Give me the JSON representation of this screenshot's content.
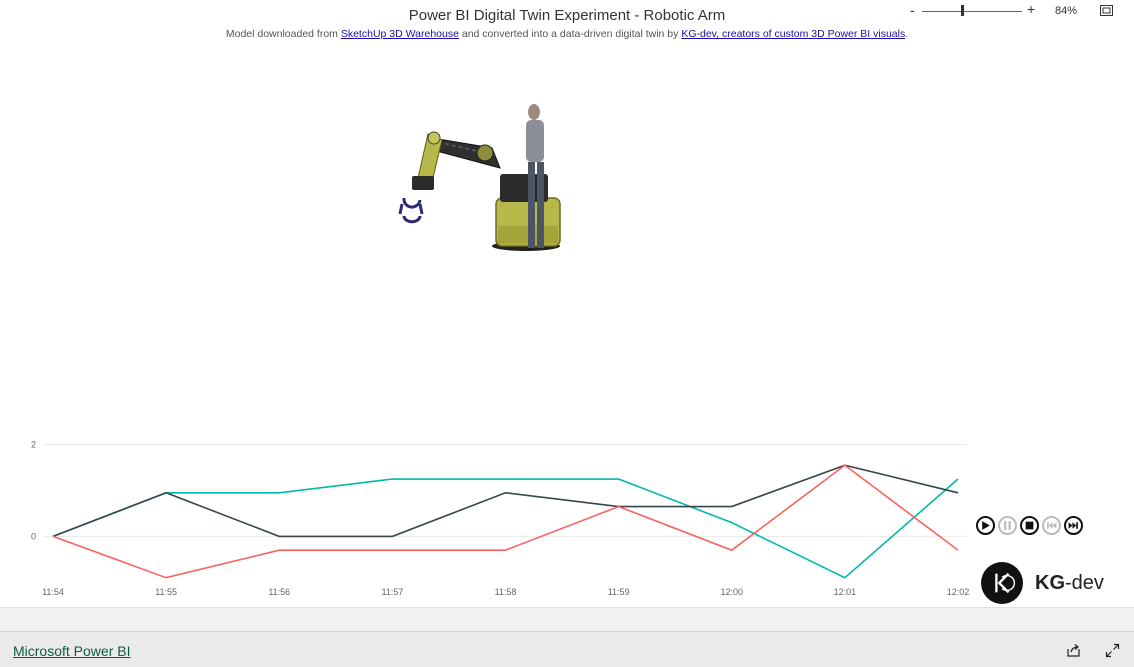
{
  "report": {
    "title": "Power BI Digital Twin Experiment - Robotic Arm",
    "subtitle_pre": "Model downloaded from ",
    "subtitle_link1": "SketchUp 3D Warehouse",
    "subtitle_mid": " and converted into a data-driven digital twin by ",
    "subtitle_link2": "KG-dev, creators of custom 3D Power BI visuals",
    "subtitle_post": "."
  },
  "chart_data": {
    "type": "line",
    "categories": [
      "11:54",
      "11:55",
      "11:56",
      "11:57",
      "11:58",
      "11:59",
      "12:00",
      "12:01",
      "12:02"
    ],
    "yticks": [
      0,
      2
    ],
    "ylim": [
      -0.95,
      2.1
    ],
    "grid": true,
    "series": [
      {
        "color": "#01b8aa",
        "values": [
          0,
          0.95,
          0.95,
          1.25,
          1.25,
          1.25,
          0.3,
          -0.9,
          1.25
        ]
      },
      {
        "color": "#374649",
        "values": [
          0,
          0.95,
          0,
          0,
          0.95,
          0.65,
          0.65,
          1.55,
          0.95
        ]
      },
      {
        "color": "#fd625e",
        "values": [
          0,
          -0.9,
          -0.3,
          -0.3,
          -0.3,
          0.65,
          -0.3,
          1.55,
          -0.3
        ]
      }
    ]
  },
  "brand": {
    "name_bold": "KG",
    "name_rest": "-dev"
  },
  "zoom": {
    "minus": "-",
    "plus": "+",
    "percent": "84%",
    "level": 0.4
  },
  "footer": {
    "link": "Microsoft Power BI"
  }
}
